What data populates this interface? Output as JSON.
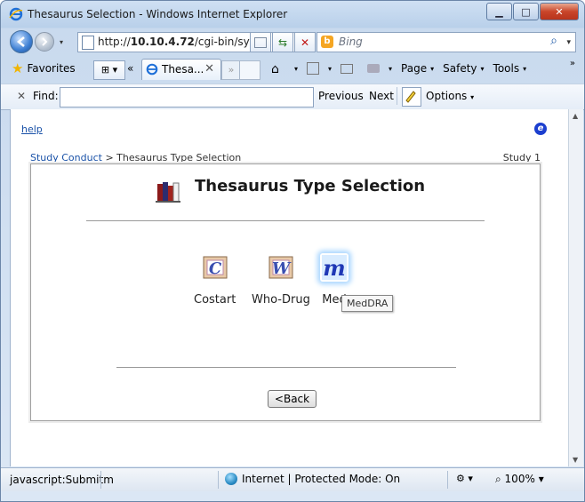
{
  "window": {
    "title": "Thesaurus Selection - Windows Internet Explorer",
    "controls": {
      "minimize": "▁",
      "maximize": "□",
      "close": "✕"
    }
  },
  "address": {
    "url_prefix": "http://",
    "url_host": "10.10.4.72",
    "url_path": "/cgi-bin/sym",
    "dropdown": "▾"
  },
  "search": {
    "placeholder": "Bing",
    "engine_glyph": "b",
    "glyph": "⌕"
  },
  "favorites": {
    "label": "Favorites"
  },
  "tabs": {
    "active_label": "Thesa...",
    "close_glyph": "✕",
    "nav_glyph": "«",
    "next_glyph": "»",
    "grid_glyph": "⊞ ▾"
  },
  "commands": {
    "page": "Page",
    "safety": "Safety",
    "tools": "Tools",
    "more": "»"
  },
  "find": {
    "close": "✕",
    "label": "Find:",
    "value": "",
    "previous": "Previous",
    "next": "Next",
    "options": "Options"
  },
  "page": {
    "help_link": "help",
    "e_glyph": "e",
    "breadcrumb_link": "Study Conduct",
    "breadcrumb_sep": " > ",
    "breadcrumb_current": "Thesaurus Type Selection",
    "study": "Study 1",
    "heading": "Thesaurus Type Selection",
    "choices": [
      {
        "label": "Costart",
        "glyph": "C"
      },
      {
        "label": "Who-Drug",
        "glyph": "W"
      },
      {
        "label": "Med",
        "glyph": "m"
      }
    ],
    "tooltip": "MedDRA",
    "back_button": "<Back"
  },
  "status": {
    "text": "javascript:Submitm",
    "zone": "Internet | Protected Mode: On",
    "zoom": "100%",
    "caret": "▾"
  },
  "colors": {
    "link": "#1a52a8",
    "ie_blue": "#1c3fcf",
    "tooltip_bg": "#f6f6f6"
  }
}
